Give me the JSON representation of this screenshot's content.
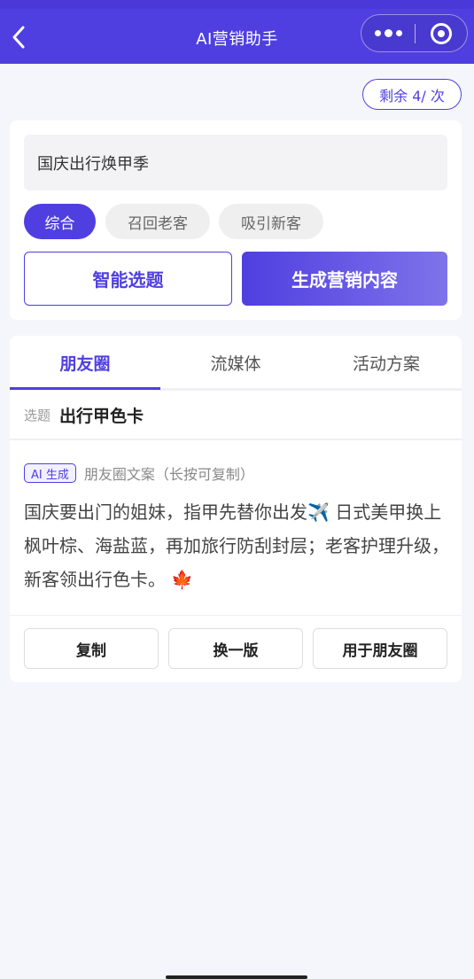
{
  "colors": {
    "accent": "#4f3fe0",
    "background": "#f5f6fb"
  },
  "navbar": {
    "title": "AI营销助手",
    "back_icon": "chevron-left-icon",
    "more_icon": "more-dots-icon",
    "close_icon": "target-circle-icon"
  },
  "quota": {
    "label": "剩余 4/ 次"
  },
  "input": {
    "topic_value": "国庆出行焕甲季"
  },
  "chips": [
    {
      "label": "综合",
      "active": true
    },
    {
      "label": "召回老客",
      "active": false
    },
    {
      "label": "吸引新客",
      "active": false
    }
  ],
  "actions": {
    "smart_topic_label": "智能选题",
    "generate_label": "生成营销内容"
  },
  "tabs": [
    {
      "label": "朋友圈",
      "active": true
    },
    {
      "label": "流媒体",
      "active": false
    },
    {
      "label": "活动方案",
      "active": false
    }
  ],
  "result": {
    "topic_label": "选题",
    "topic_value": "出行甲色卡",
    "ai_badge": "AI 生成",
    "hint": "朋友圈文案（长按可复制）",
    "text_part1": "国庆要出门的姐妹，指甲先替你出发",
    "emoji1": "✈️",
    "text_part2": " 日式美甲换上枫叶棕、海盐蓝，再加旅行防刮封层；老客护理升级，新客领出行色卡。",
    "emoji2": "🍁"
  },
  "result_actions": {
    "copy_label": "复制",
    "regenerate_label": "换一版",
    "use_label": "用于朋友圈"
  }
}
